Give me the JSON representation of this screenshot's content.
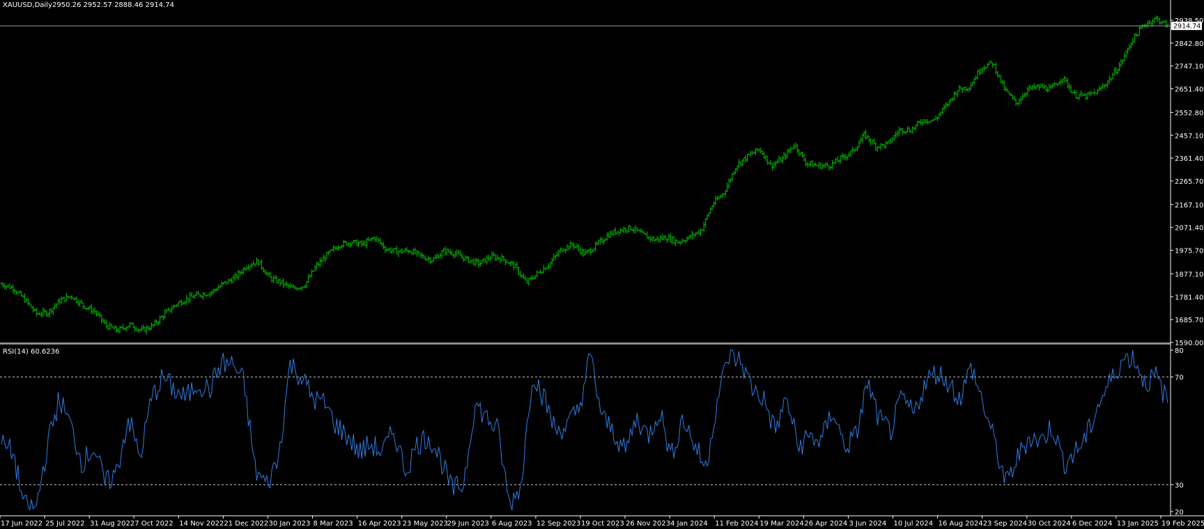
{
  "window": {
    "symbol": "XAUUSD",
    "timeframe": "Daily",
    "ohlc_readout": "2950.26 2952.57 2888.46 2914.74",
    "current_price_label": "2914.74"
  },
  "rsi_panel": {
    "label": "RSI(14)",
    "value_text": "60.6236"
  },
  "colors": {
    "background": "#000000",
    "candles": "#00c800",
    "rsi_line": "#2f7fe6",
    "axis_text": "#ffffff",
    "price_line": "#8ea3b8",
    "level_lines": "#c8c8c8",
    "separator": "#8c8c8c"
  },
  "chart_data": [
    {
      "type": "candlestick",
      "title": "XAUUSD,Daily",
      "y_ticks": [
        "2938.50",
        "2842.80",
        "2747.10",
        "2651.40",
        "2552.80",
        "2457.10",
        "2361.40",
        "2265.70",
        "2167.10",
        "2071.40",
        "1975.70",
        "1877.10",
        "1781.40",
        "1685.70",
        "1590.00"
      ],
      "ylim": [
        1590.0,
        2938.5
      ],
      "current_price": 2914.74,
      "x_tick_labels": [
        "17 Jun 2022",
        "25 Jul 2022",
        "31 Aug 2022",
        "7 Oct 2022",
        "14 Nov 2022",
        "21 Dec 2022",
        "30 Jan 2023",
        "8 Mar 2023",
        "16 Apr 2023",
        "23 May 2023",
        "29 Jun 2023",
        "6 Aug 2023",
        "12 Sep 2023",
        "19 Oct 2023",
        "26 Nov 2023",
        "4 Jan 2024",
        "11 Feb 2024",
        "19 Mar 2024",
        "26 Apr 2024",
        "3 Jun 2024",
        "10 Jul 2024",
        "16 Aug 2024",
        "23 Sep 2024",
        "30 Oct 2024",
        "6 Dec 2024",
        "13 Jan 2025",
        "19 Feb 2025"
      ],
      "price_path": [
        1835,
        1818,
        1770,
        1710,
        1715,
        1765,
        1785,
        1745,
        1720,
        1660,
        1640,
        1665,
        1640,
        1660,
        1710,
        1750,
        1775,
        1790,
        1800,
        1835,
        1860,
        1910,
        1930,
        1860,
        1840,
        1815,
        1830,
        1910,
        1960,
        2000,
        2010,
        2000,
        2030,
        1980,
        1970,
        1975,
        1950,
        1935,
        1975,
        1960,
        1935,
        1920,
        1950,
        1940,
        1910,
        1840,
        1880,
        1920,
        1980,
        2000,
        1960,
        1995,
        2040,
        2060,
        2070,
        2040,
        2020,
        2030,
        2010,
        2030,
        2060,
        2170,
        2220,
        2330,
        2370,
        2400,
        2330,
        2360,
        2420,
        2340,
        2330,
        2330,
        2360,
        2390,
        2460,
        2410,
        2420,
        2480,
        2480,
        2520,
        2520,
        2580,
        2650,
        2660,
        2740,
        2760,
        2650,
        2590,
        2650,
        2660,
        2650,
        2700,
        2625,
        2620,
        2640,
        2690,
        2760,
        2860,
        2920,
        2945,
        2914.74
      ],
      "volatility_note": "",
      "candle_count": 700
    },
    {
      "type": "line",
      "title": "RSI(14) 60.6236",
      "y_ticks": [
        "80",
        "70",
        "30",
        "20"
      ],
      "ylim": [
        20,
        80
      ],
      "levels": [
        70,
        30
      ],
      "current_value": 60.6236,
      "series": [
        {
          "values": [
            45,
            42,
            22,
            21,
            45,
            62,
            52,
            38,
            44,
            30,
            35,
            55,
            40,
            62,
            70,
            65,
            62,
            68,
            65,
            75,
            75,
            68,
            35,
            30,
            40,
            75,
            70,
            62,
            60,
            52,
            48,
            42,
            45,
            42,
            50,
            35,
            45,
            48,
            40,
            28,
            30,
            60,
            55,
            50,
            22,
            30,
            72,
            62,
            50,
            52,
            58,
            78,
            55,
            50,
            42,
            55,
            48,
            58,
            40,
            55,
            45,
            36,
            62,
            78,
            76,
            66,
            62,
            50,
            62,
            44,
            48,
            46,
            58,
            44,
            48,
            68,
            54,
            50,
            62,
            56,
            68,
            72,
            68,
            62,
            74,
            60,
            46,
            30,
            40,
            48,
            46,
            52,
            38,
            42,
            48,
            60,
            68,
            76,
            78,
            68,
            70,
            60.62
          ]
        }
      ]
    }
  ]
}
